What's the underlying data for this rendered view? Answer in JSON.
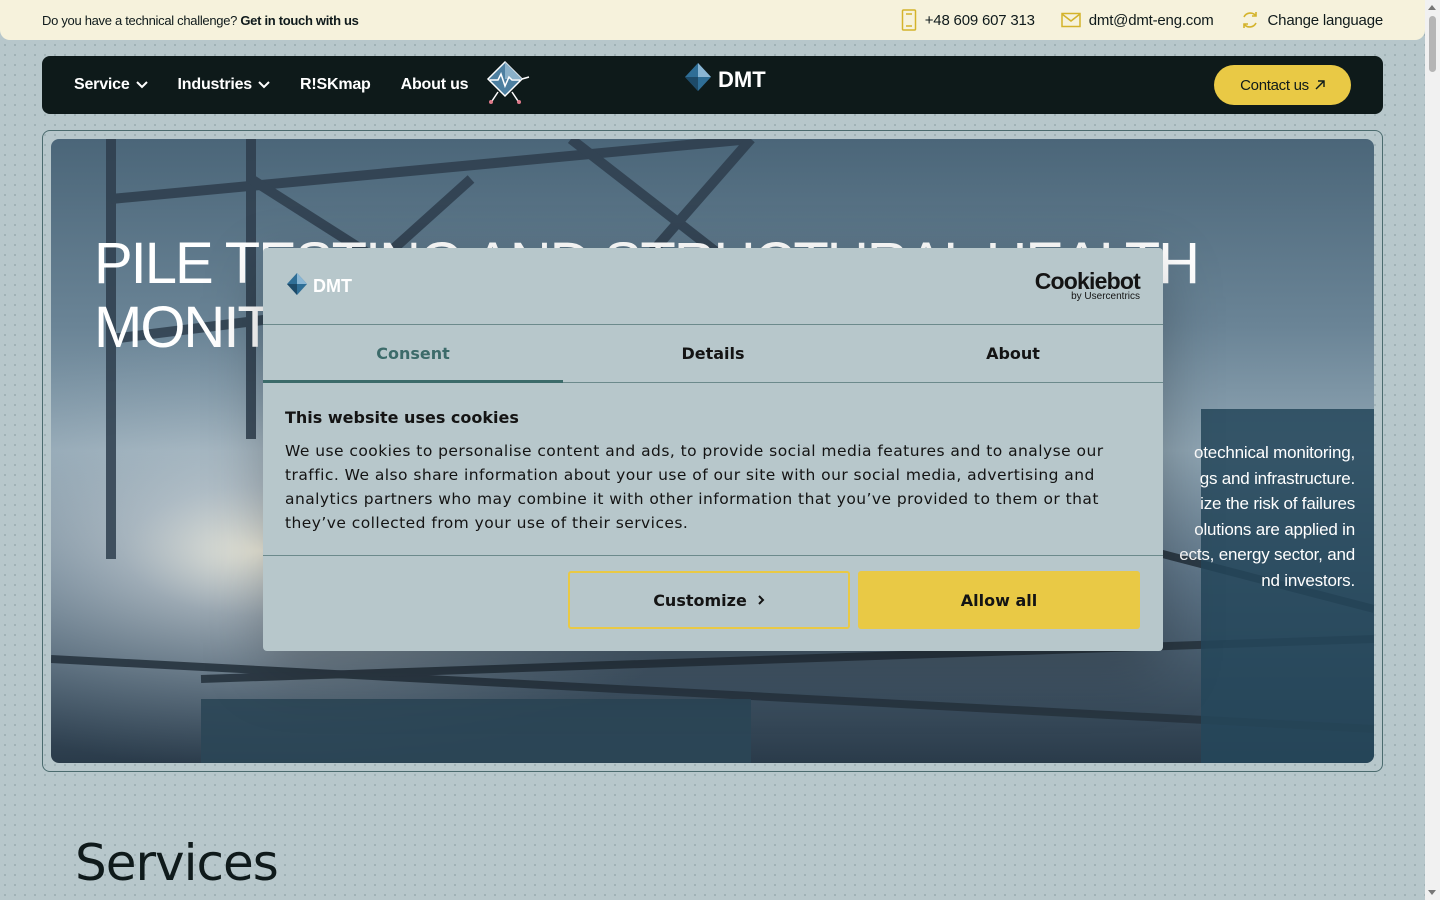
{
  "topbar": {
    "challenge_text": "Do you have a technical challenge?",
    "challenge_link": "Get in touch with us",
    "phone": "+48 609 607 313",
    "email": "dmt@dmt-eng.com",
    "language": "Change language"
  },
  "nav": {
    "items": [
      {
        "label": "Service",
        "has_dropdown": true
      },
      {
        "label": "Industries",
        "has_dropdown": true
      },
      {
        "label": "R!SKmap",
        "has_dropdown": false
      },
      {
        "label": "About us",
        "has_dropdown": false
      }
    ],
    "logo_text": "DMT",
    "contact_label": "Contact us"
  },
  "hero": {
    "title_line1": "PILE TESTING AND STRUCTURAL HEALTH",
    "title_line2": "MONIT",
    "desc_lines": [
      "otechnical monitoring,",
      "gs and infrastructure.",
      "ize the risk of failures",
      "olutions are applied in",
      "ects, energy sector, and",
      "nd investors."
    ]
  },
  "services": {
    "title": "Services"
  },
  "cookie_dialog": {
    "brand": "DMT",
    "provider": "Cookiebot",
    "provider_sub": "by Usercentrics",
    "tabs": [
      "Consent",
      "Details",
      "About"
    ],
    "active_tab": "Consent",
    "heading": "This website uses cookies",
    "body": "We use cookies to personalise content and ads, to provide social media features and to analyse our traffic. We also share information about your use of our site with our social media, advertising and analytics partners who may combine it with other information that you’ve provided to them or that they’ve collected from your use of their services.",
    "customize_label": "Customize",
    "allow_label": "Allow all"
  },
  "colors": {
    "accent_yellow": "#e9c945",
    "nav_bg": "#0e1a1a",
    "page_bg": "#b7c7cb",
    "topbar_bg": "#f6f2dc",
    "active_tab": "#3c6b6a"
  }
}
